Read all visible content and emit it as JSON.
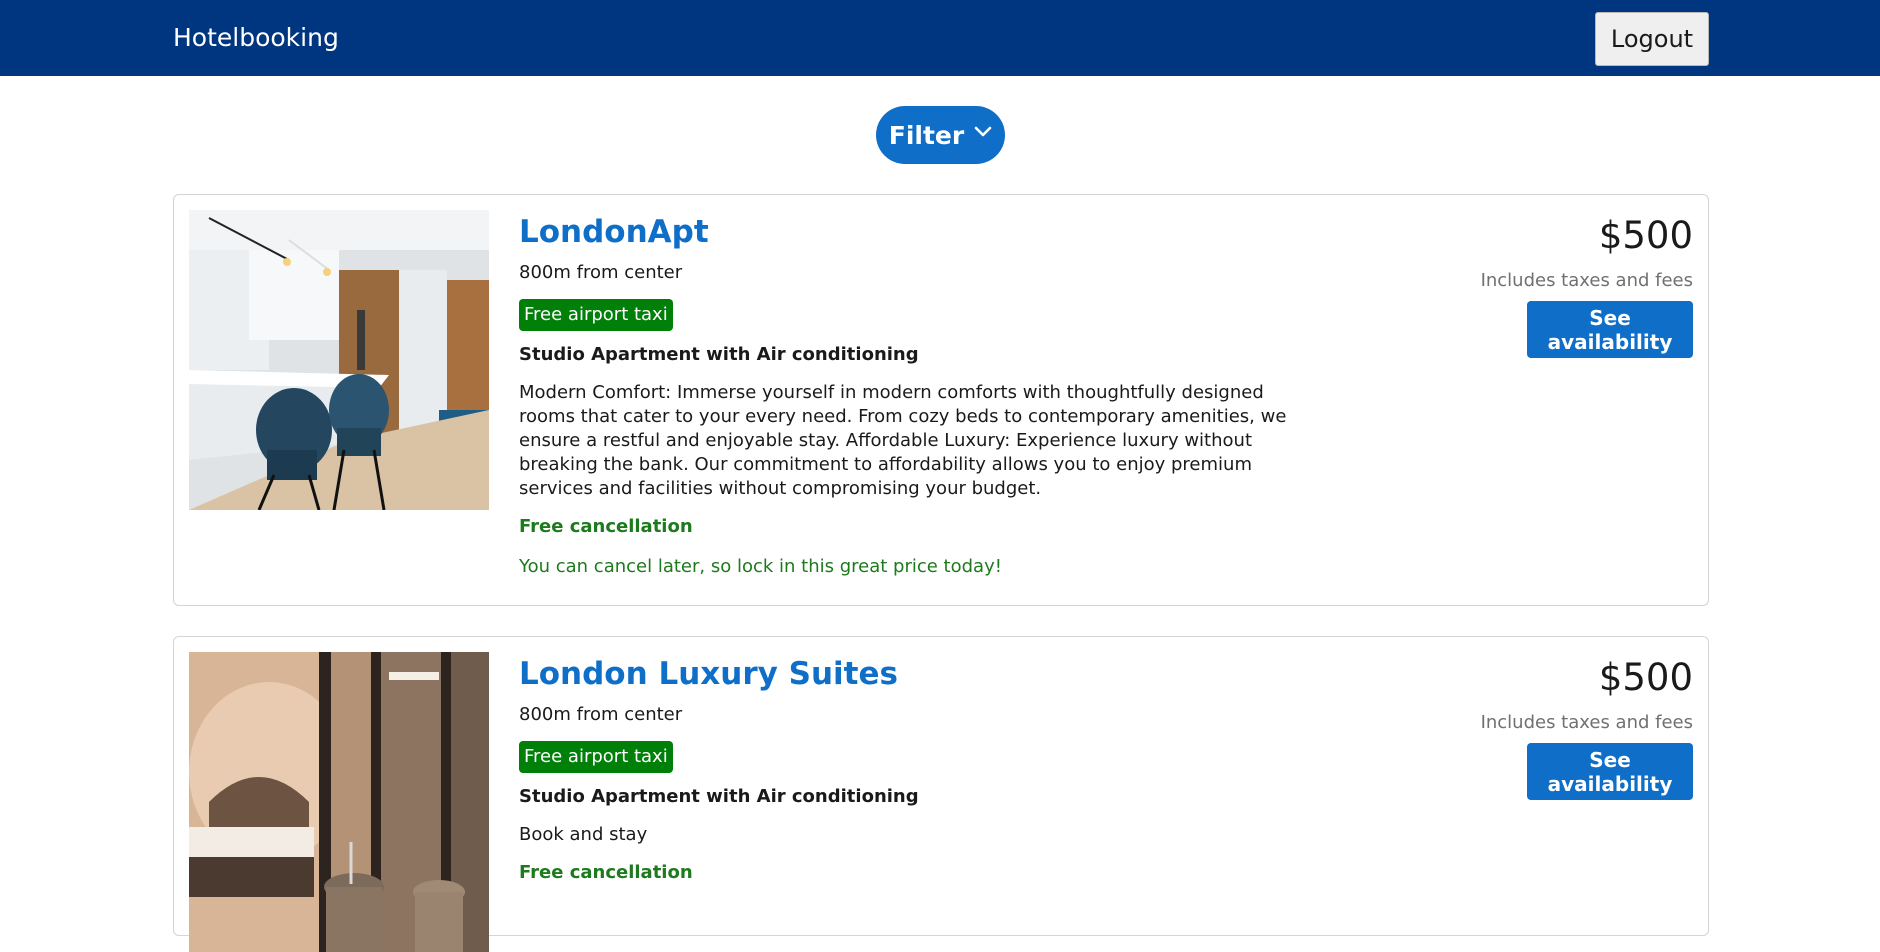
{
  "header": {
    "brand": "Hotelbooking",
    "logout_label": "Logout"
  },
  "filter": {
    "label": "Filter",
    "icon": "chevron-down-icon"
  },
  "colors": {
    "header_bg": "#003580",
    "primary": "#0f6ec8",
    "badge_green": "#008009",
    "success_text": "#1d7a1d"
  },
  "listings": [
    {
      "name": "LondonApt",
      "distance": "800m from center",
      "badge": "Free airport taxi",
      "room_type": "Studio Apartment with Air conditioning",
      "description": "Modern Comfort: Immerse yourself in modern comforts with thoughtfully designed rooms that cater to your every need. From cozy beds to contemporary amenities, we ensure a restful and enjoyable stay. Affordable Luxury: Experience luxury without breaking the bank. Our commitment to affordability allows you to enjoy premium services and facilities without compromising your budget.",
      "free_cancellation": "Free cancellation",
      "cancel_note": "You can cancel later, so lock in this great price today!",
      "price": "$500",
      "taxes_note": "Includes taxes and fees",
      "availability_label": "See availability"
    },
    {
      "name": "London Luxury Suites",
      "distance": "800m from center",
      "badge": "Free airport taxi",
      "room_type": "Studio Apartment with Air conditioning",
      "description": "Book and stay",
      "free_cancellation": "Free cancellation",
      "price": "$500",
      "taxes_note": "Includes taxes and fees",
      "availability_label": "See availability"
    }
  ]
}
